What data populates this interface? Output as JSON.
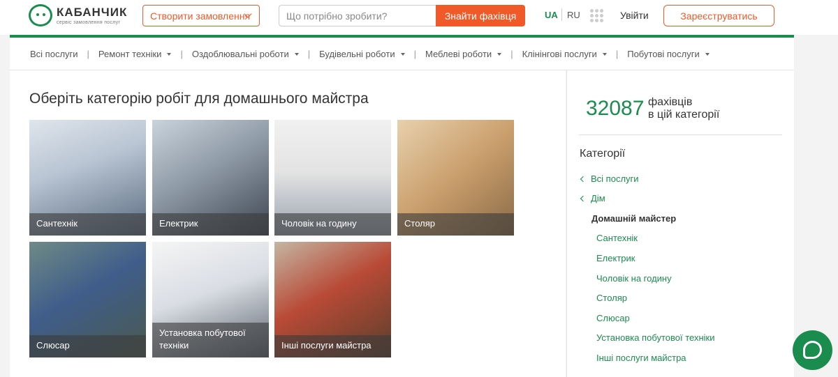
{
  "header": {
    "logo_title": "КАБАНЧИК",
    "logo_subtitle": "сервіс замовлення послуг",
    "create_order_label": "Створити замовлення",
    "search_placeholder": "Що потрібно зробити?",
    "search_button": "Знайти фахівця",
    "lang_ua": "UA",
    "lang_ru": "RU",
    "login": "Увійти",
    "register": "Зареєструватись"
  },
  "nav": {
    "items": [
      {
        "label": "Всі послуги",
        "dropdown": false
      },
      {
        "label": "Ремонт техніки",
        "dropdown": true
      },
      {
        "label": "Оздоблювальні роботи",
        "dropdown": true
      },
      {
        "label": "Будівельні роботи",
        "dropdown": true
      },
      {
        "label": "Меблеві роботи",
        "dropdown": true
      },
      {
        "label": "Клінінгові послуги",
        "dropdown": true
      },
      {
        "label": "Побутові послуги",
        "dropdown": true
      }
    ],
    "separator": "|"
  },
  "main": {
    "title": "Оберіть категорію робіт для домашнього майстра",
    "tiles": [
      {
        "label": "Сантехнік"
      },
      {
        "label": "Електрик"
      },
      {
        "label": "Чоловік на годину"
      },
      {
        "label": "Столяр"
      },
      {
        "label": "Слюсар"
      },
      {
        "label": "Установка побутової техніки"
      },
      {
        "label": "Інші послуги майстра"
      }
    ]
  },
  "sidebar": {
    "count": "32087",
    "count_label_1": "фахівців",
    "count_label_2": "в цій категорії",
    "categories_title": "Категорії",
    "back_links": [
      "Всі послуги",
      "Дім"
    ],
    "current": "Домашній майстер",
    "sub_links": [
      "Сантехнік",
      "Електрик",
      "Чоловік на годину",
      "Столяр",
      "Слюсар",
      "Установка побутової техніки",
      "Інші послуги майстра"
    ]
  },
  "colors": {
    "brand_green": "#1a8c4e",
    "accent_orange": "#f05a28"
  }
}
